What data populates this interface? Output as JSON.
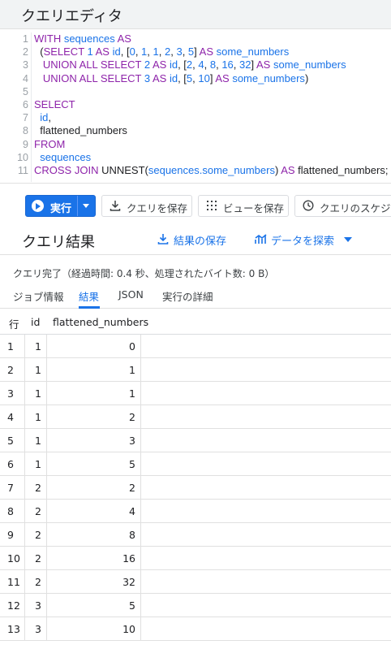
{
  "editor_panel": {
    "title": "クエリエディタ"
  },
  "code_lines": [
    {
      "n": "1",
      "tokens": [
        [
          "kw",
          "WITH "
        ],
        [
          "id",
          "sequences "
        ],
        [
          "kw",
          "AS"
        ]
      ]
    },
    {
      "n": "2",
      "tokens": [
        [
          "p",
          "  ("
        ],
        [
          "kw",
          "SELECT "
        ],
        [
          "num",
          "1 "
        ],
        [
          "kw",
          "AS "
        ],
        [
          "id",
          "id"
        ],
        [
          "p",
          ", ["
        ],
        [
          "num",
          "0"
        ],
        [
          "p",
          ", "
        ],
        [
          "num",
          "1"
        ],
        [
          "p",
          ", "
        ],
        [
          "num",
          "1"
        ],
        [
          "p",
          ", "
        ],
        [
          "num",
          "2"
        ],
        [
          "p",
          ", "
        ],
        [
          "num",
          "3"
        ],
        [
          "p",
          ", "
        ],
        [
          "num",
          "5"
        ],
        [
          "p",
          "] "
        ],
        [
          "kw",
          "AS "
        ],
        [
          "id",
          "some_numbers"
        ]
      ]
    },
    {
      "n": "3",
      "tokens": [
        [
          "p",
          "   "
        ],
        [
          "kw",
          "UNION ALL SELECT "
        ],
        [
          "num",
          "2 "
        ],
        [
          "kw",
          "AS "
        ],
        [
          "id",
          "id"
        ],
        [
          "p",
          ", ["
        ],
        [
          "num",
          "2"
        ],
        [
          "p",
          ", "
        ],
        [
          "num",
          "4"
        ],
        [
          "p",
          ", "
        ],
        [
          "num",
          "8"
        ],
        [
          "p",
          ", "
        ],
        [
          "num",
          "16"
        ],
        [
          "p",
          ", "
        ],
        [
          "num",
          "32"
        ],
        [
          "p",
          "] "
        ],
        [
          "kw",
          "AS "
        ],
        [
          "id",
          "some_numbers"
        ]
      ]
    },
    {
      "n": "4",
      "tokens": [
        [
          "p",
          "   "
        ],
        [
          "kw",
          "UNION ALL SELECT "
        ],
        [
          "num",
          "3 "
        ],
        [
          "kw",
          "AS "
        ],
        [
          "id",
          "id"
        ],
        [
          "p",
          ", ["
        ],
        [
          "num",
          "5"
        ],
        [
          "p",
          ", "
        ],
        [
          "num",
          "10"
        ],
        [
          "p",
          "] "
        ],
        [
          "kw",
          "AS "
        ],
        [
          "id",
          "some_numbers"
        ],
        [
          "p",
          ")"
        ]
      ]
    },
    {
      "n": "5",
      "tokens": []
    },
    {
      "n": "6",
      "tokens": [
        [
          "kw",
          "SELECT"
        ]
      ]
    },
    {
      "n": "7",
      "tokens": [
        [
          "p",
          "  "
        ],
        [
          "id",
          "id"
        ],
        [
          "p",
          ","
        ]
      ]
    },
    {
      "n": "8",
      "tokens": [
        [
          "p",
          "  flattened_numbers"
        ]
      ]
    },
    {
      "n": "9",
      "tokens": [
        [
          "kw",
          "FROM"
        ]
      ]
    },
    {
      "n": "10",
      "tokens": [
        [
          "p",
          "  "
        ],
        [
          "id",
          "sequences"
        ]
      ]
    },
    {
      "n": "11",
      "tokens": [
        [
          "kw",
          "CROSS JOIN "
        ],
        [
          "p",
          "UNNEST("
        ],
        [
          "id",
          "sequences.some_numbers"
        ],
        [
          "p",
          ") "
        ],
        [
          "kw",
          "AS "
        ],
        [
          "p",
          "flattened_numbers;"
        ]
      ]
    }
  ],
  "toolbar": {
    "run_label": "実行",
    "save_query_label": "クエリを保存",
    "save_view_label": "ビューを保存",
    "schedule_label": "クエリのスケジュール"
  },
  "results": {
    "title": "クエリ結果",
    "save_results_label": "結果の保存",
    "explore_label": "データを探索",
    "status": "クエリ完了（経過時間: 0.4 秒、処理されたバイト数: 0 B）",
    "tabs": [
      "ジョブ情報",
      "結果",
      "JSON",
      "実行の詳細"
    ],
    "active_tab": "結果",
    "columns": [
      "行",
      "id",
      "flattened_numbers"
    ],
    "rows": [
      [
        "1",
        "1",
        "0"
      ],
      [
        "2",
        "1",
        "1"
      ],
      [
        "3",
        "1",
        "1"
      ],
      [
        "4",
        "1",
        "2"
      ],
      [
        "5",
        "1",
        "3"
      ],
      [
        "6",
        "1",
        "5"
      ],
      [
        "7",
        "2",
        "2"
      ],
      [
        "8",
        "2",
        "4"
      ],
      [
        "9",
        "2",
        "8"
      ],
      [
        "10",
        "2",
        "16"
      ],
      [
        "11",
        "2",
        "32"
      ],
      [
        "12",
        "3",
        "5"
      ],
      [
        "13",
        "3",
        "10"
      ]
    ]
  },
  "colors": {
    "accent": "#1a73e8",
    "keyword": "#8e24aa"
  }
}
